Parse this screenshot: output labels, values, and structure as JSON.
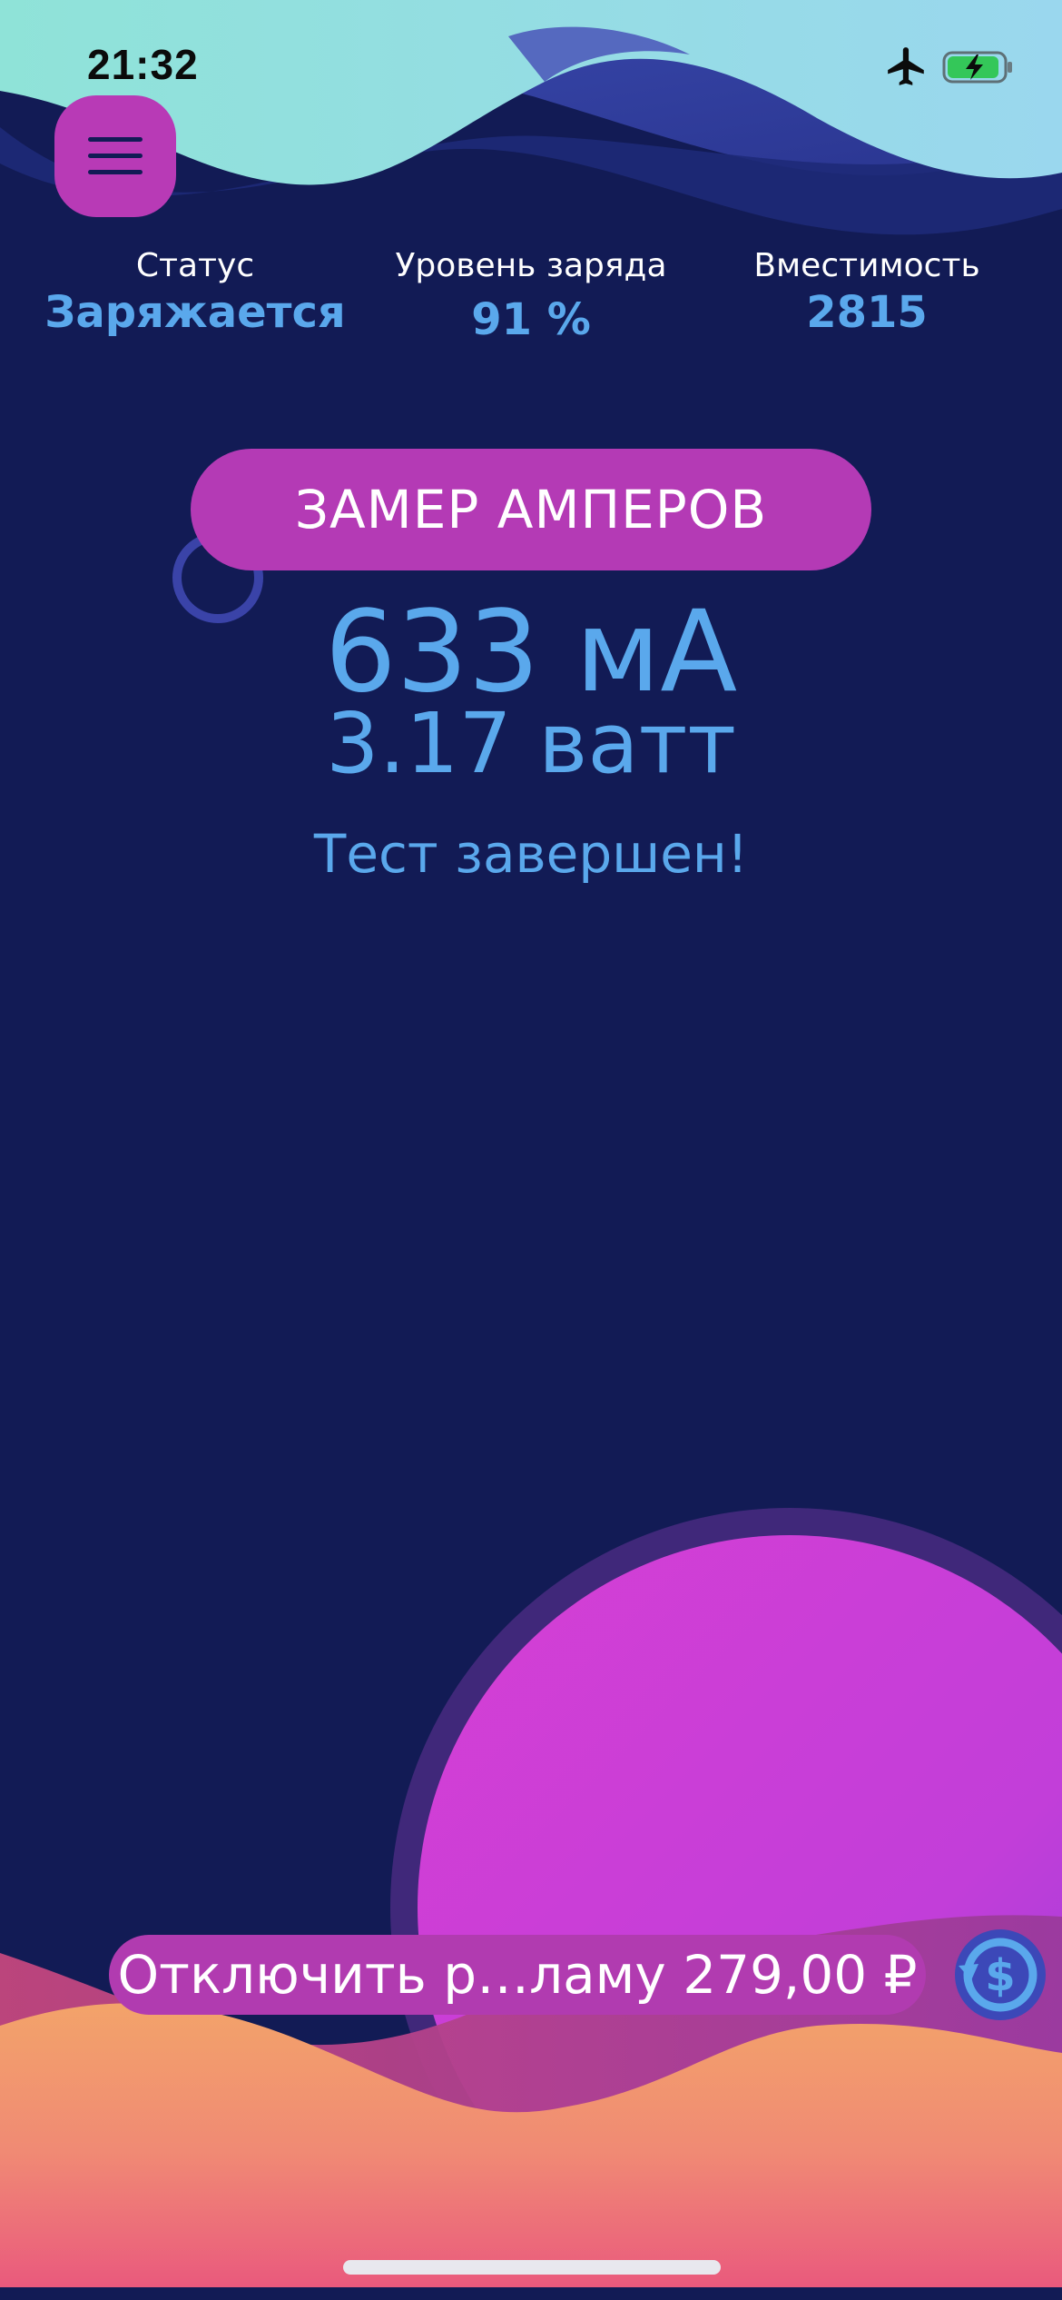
{
  "status_bar": {
    "time": "21:32",
    "icons": [
      "airplane-icon",
      "battery-charging-icon"
    ]
  },
  "menu": {
    "icon": "hamburger-menu-icon"
  },
  "stats": {
    "status_label": "Статус",
    "status_value": "Заряжается",
    "level_label": "Уровень заряда",
    "level_value": "91 %",
    "capacity_label": "Вместимость",
    "capacity_value": "2815"
  },
  "measure": {
    "button_label": "ЗАМЕР АМПЕРОВ",
    "current": "633 мА",
    "power": "3.17 ватт",
    "status": "Тест завершен!"
  },
  "purchase": {
    "remove_ads_label": "Отключить р…ламу 279,00 ₽",
    "restore_icon": "restore-purchase-icon"
  },
  "colors": {
    "background": "#121b55",
    "accent_magenta": "#b43ab5",
    "value_blue": "#5aa8ec"
  }
}
